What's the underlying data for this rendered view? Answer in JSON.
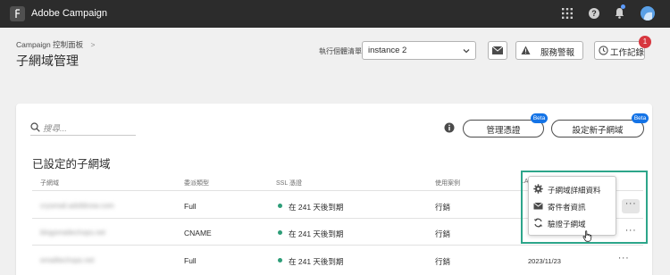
{
  "app": {
    "title": "Adobe Campaign"
  },
  "topbar": {
    "icons": [
      "apps-grid-icon",
      "help-icon",
      "bell-icon",
      "avatar"
    ]
  },
  "header": {
    "breadcrumb": "Campaign 控制面板",
    "breadcrumb_sep": ">",
    "title": "子網域管理",
    "instance_label": "執行個體清單",
    "instance_value": "instance 2",
    "alerts_label": "服務警報",
    "joblog_label": "工作記錄",
    "joblog_badge": "1"
  },
  "toolbar": {
    "search_placeholder": "搜尋...",
    "credentials_label": "管理憑證",
    "new_subdomain_label": "設定新子網域",
    "beta_label": "Beta"
  },
  "section": {
    "title": "已設定的子網域"
  },
  "table": {
    "columns": [
      "子網域",
      "委派類型",
      "SSL 憑證",
      "使用案例",
      "LA"
    ],
    "rows": [
      {
        "subdomain": "crysmail.adsfdnow.com",
        "delegation": "Full",
        "ssl": "在 241 天後到期",
        "use_case": "行銷",
        "date": ""
      },
      {
        "subdomain": "blogsmailechops.net",
        "delegation": "CNAME",
        "ssl": "在 241 天後到期",
        "use_case": "行銷",
        "date": ""
      },
      {
        "subdomain": "emailtechops.net",
        "delegation": "Full",
        "ssl": "在 241 天後到期",
        "use_case": "行銷",
        "date": "2023/11/23"
      }
    ]
  },
  "context_menu": {
    "items": [
      {
        "label": "子網域詳細資料",
        "icon": "gear-icon"
      },
      {
        "label": "寄件者資訊",
        "icon": "mail-icon"
      },
      {
        "label": "驗證子網域",
        "icon": "refresh-icon"
      }
    ]
  },
  "colors": {
    "topbar": "#2c2c2c",
    "accent": "#1473e6",
    "highlight_frame": "#2da58a",
    "ssl_ok": "#2d9d78",
    "badge": "#d7373f"
  }
}
